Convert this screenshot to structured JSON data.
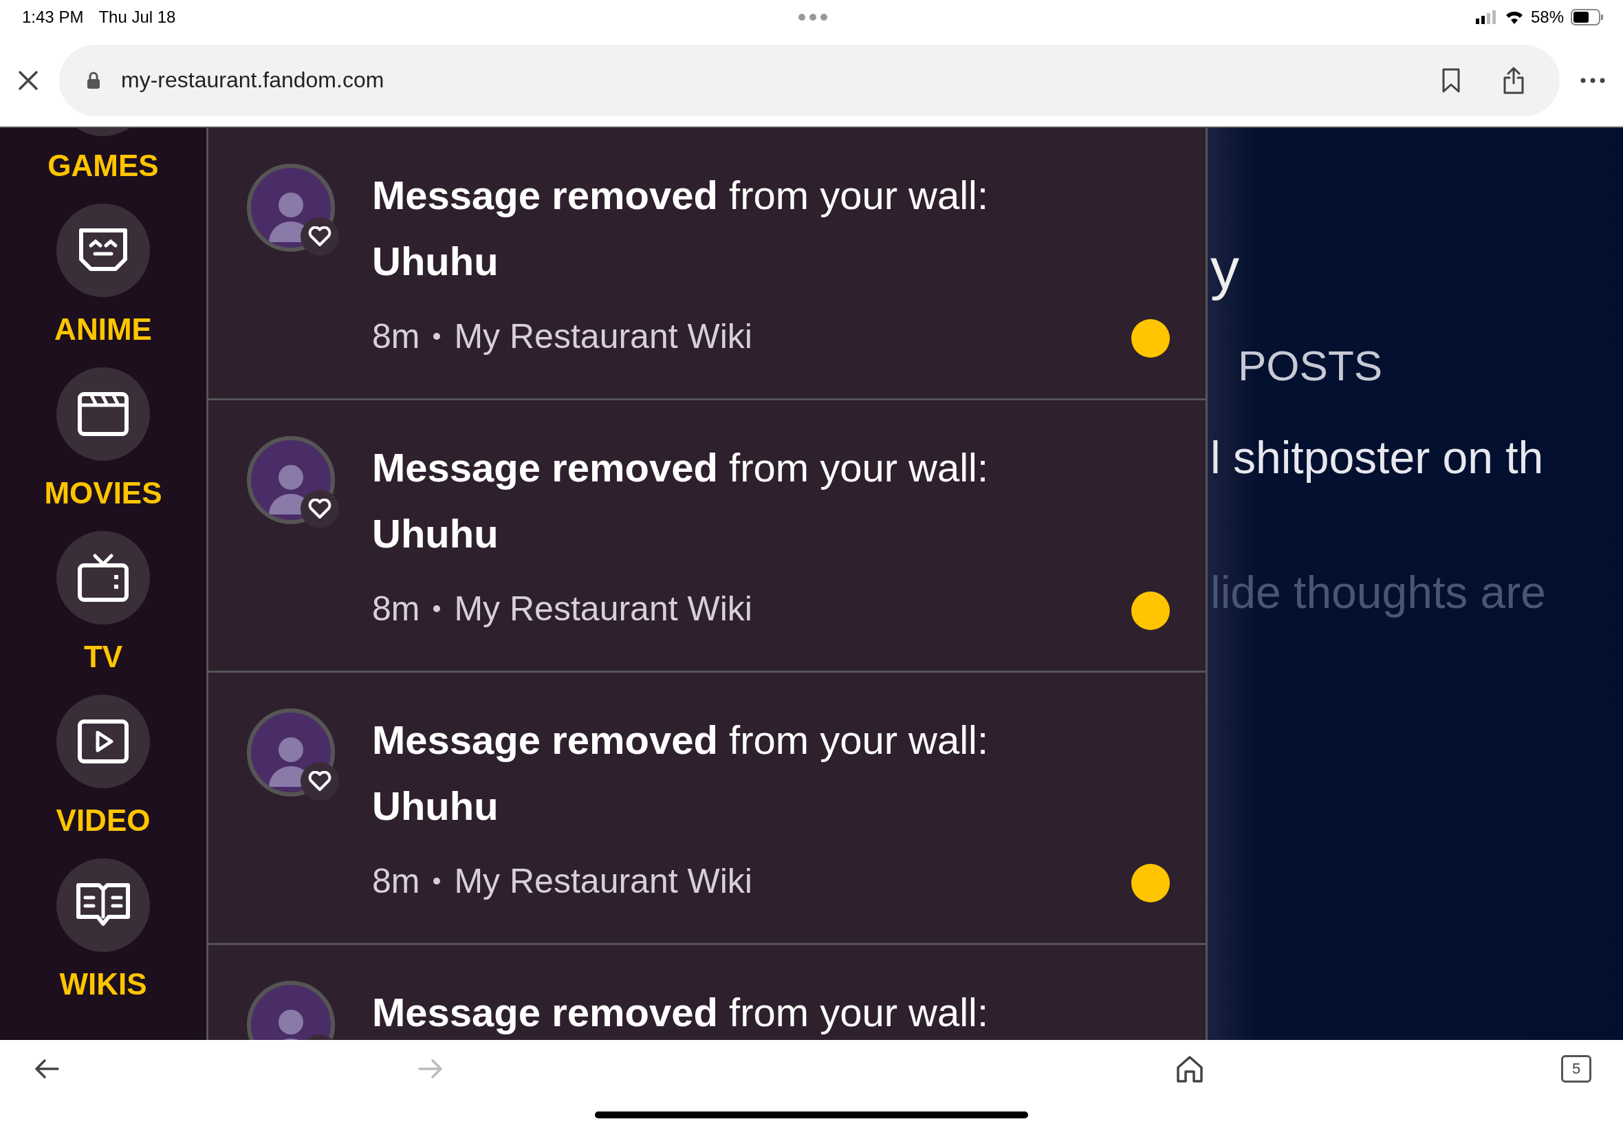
{
  "status_bar": {
    "time": "1:43 PM",
    "date": "Thu Jul 18",
    "battery": "58%"
  },
  "browser": {
    "url": "my-restaurant.fandom.com",
    "tab_count": "5"
  },
  "sidebar": {
    "items": [
      {
        "label": "GAMES"
      },
      {
        "label": "ANIME"
      },
      {
        "label": "MOVIES"
      },
      {
        "label": "TV"
      },
      {
        "label": "VIDEO"
      },
      {
        "label": "WIKIS"
      }
    ]
  },
  "notifications": [
    {
      "title": "**Message removed** from your wall:",
      "subject": "Uhuhu",
      "time": "8m",
      "wiki": "My Restaurant Wiki",
      "unread": true
    },
    {
      "title": "**Message removed** from your wall:",
      "subject": "Uhuhu",
      "time": "8m",
      "wiki": "My Restaurant Wiki",
      "unread": true
    },
    {
      "title": "**Message removed** from your wall:",
      "subject": "Uhuhu",
      "time": "8m",
      "wiki": "My Restaurant Wiki",
      "unread": true
    },
    {
      "title": "**Message removed** from your wall:"
    }
  ],
  "background_profile": {
    "name_fragment": "y",
    "posts_fragment": "POSTS",
    "bio_fragment": "l shitposter on th",
    "faded_fragment": "lide thoughts are"
  }
}
